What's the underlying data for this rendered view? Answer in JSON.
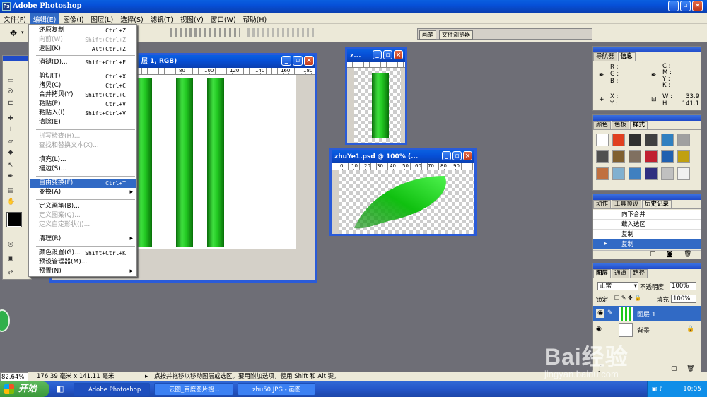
{
  "app": {
    "title": "Adobe Photoshop"
  },
  "menubar": [
    {
      "label": "文件(F)",
      "active": false
    },
    {
      "label": "编辑(E)",
      "active": true
    },
    {
      "label": "图像(I)",
      "active": false
    },
    {
      "label": "图层(L)",
      "active": false
    },
    {
      "label": "选择(S)",
      "active": false
    },
    {
      "label": "滤镜(T)",
      "active": false
    },
    {
      "label": "视图(V)",
      "active": false
    },
    {
      "label": "窗口(W)",
      "active": false
    },
    {
      "label": "帮助(H)",
      "active": false
    }
  ],
  "optbar": {
    "tab_brush": "画笔",
    "tab_browser": "文件浏览器"
  },
  "edit_menu": {
    "undo": {
      "label": "还原复制",
      "shortcut": "Ctrl+Z"
    },
    "step_forward": {
      "label": "向前(W)",
      "shortcut": "Shift+Ctrl+Z"
    },
    "step_backward": {
      "label": "返回(K)",
      "shortcut": "Alt+Ctrl+Z"
    },
    "fade": {
      "label": "消褪(D)...",
      "shortcut": "Shift+Ctrl+F"
    },
    "cut": {
      "label": "剪切(T)",
      "shortcut": "Ctrl+X"
    },
    "copy": {
      "label": "拷贝(C)",
      "shortcut": "Ctrl+C"
    },
    "copy_merged": {
      "label": "合并拷贝(Y)",
      "shortcut": "Shift+Ctrl+C"
    },
    "paste": {
      "label": "粘贴(P)",
      "shortcut": "Ctrl+V"
    },
    "paste_into": {
      "label": "粘贴入(I)",
      "shortcut": "Shift+Ctrl+V"
    },
    "clear": {
      "label": "清除(E)"
    },
    "check_spelling": {
      "label": "拼写检查(H)..."
    },
    "find_replace": {
      "label": "查找和替换文本(X)..."
    },
    "fill": {
      "label": "填充(L)..."
    },
    "stroke": {
      "label": "描边(S)..."
    },
    "free_transform": {
      "label": "自由变换(F)",
      "shortcut": "Ctrl+T"
    },
    "transform": {
      "label": "变换(A)"
    },
    "define_brush": {
      "label": "定义画笔(B)..."
    },
    "define_pattern": {
      "label": "定义图案(Q)..."
    },
    "define_shape": {
      "label": "定义自定形状(J)..."
    },
    "purge": {
      "label": "清理(R)"
    },
    "color_settings": {
      "label": "颜色设置(G)...",
      "shortcut": "Shift+Ctrl+K"
    },
    "preset_manager": {
      "label": "预设管理器(M)..."
    },
    "preferences": {
      "label": "预置(N)"
    }
  },
  "doc_main": {
    "title": "层 1, RGB)",
    "ruler": [
      "80",
      "100",
      "120",
      "140",
      "160",
      "180"
    ]
  },
  "doc_small": {
    "title": "z..."
  },
  "doc_leaf": {
    "title": "zhuYe1.psd @ 100% (...",
    "ruler": [
      "0",
      "10",
      "20",
      "30",
      "40",
      "50",
      "60",
      "70",
      "80",
      "90"
    ]
  },
  "info_panel": {
    "tabs": [
      "导航器",
      "信息"
    ],
    "rgb": [
      "R :",
      "G :",
      "B :"
    ],
    "cmyk": [
      "C :",
      "M :",
      "Y :",
      "K :"
    ],
    "xy": [
      "X :",
      "Y :"
    ],
    "w_label": "W :",
    "w_value": "33.9",
    "h_label": "H :",
    "h_value": "141.1"
  },
  "swatch_panel": {
    "tabs": [
      "颜色",
      "色板",
      "样式"
    ],
    "colors": [
      "#ffffff",
      "#e04020",
      "#303030",
      "#404040",
      "#3080c0",
      "#a0a0a0",
      "#505050",
      "#806030",
      "#807060",
      "#c02030",
      "#2060b0",
      "#c0a010",
      "#c07040",
      "#80b0d0",
      "#4080c0",
      "#303080",
      "#c0c0c0",
      "#f0f0f0"
    ]
  },
  "history_panel": {
    "tabs": [
      "动作",
      "工具预设",
      "历史记录"
    ],
    "items": [
      "向下合并",
      "载入选区",
      "复制",
      "复制"
    ]
  },
  "layers_panel": {
    "tabs": [
      "图层",
      "通道",
      "路径"
    ],
    "blend_mode": "正常",
    "opacity_label": "不透明度:",
    "opacity_value": "100%",
    "lock_label": "锁定:",
    "fill_label": "填充:",
    "fill_value": "100%",
    "layers": [
      "图层 1",
      "背景"
    ]
  },
  "status": {
    "zoom": "82.64%",
    "size": "176.39 毫米 x 141.11 毫米",
    "hint": "点按并拖移以移动图层或选区。要用附加选项，使用 Shift 和 Alt 键。"
  },
  "taskbar": {
    "start": "开始",
    "tasks": [
      "Adobe Photoshop",
      "云图_百度图片搜...",
      "zhu50.JPG - 画图"
    ],
    "time": "10:05"
  },
  "watermark": {
    "text": "Bai经验",
    "url": "jingyan.baidu.com"
  }
}
